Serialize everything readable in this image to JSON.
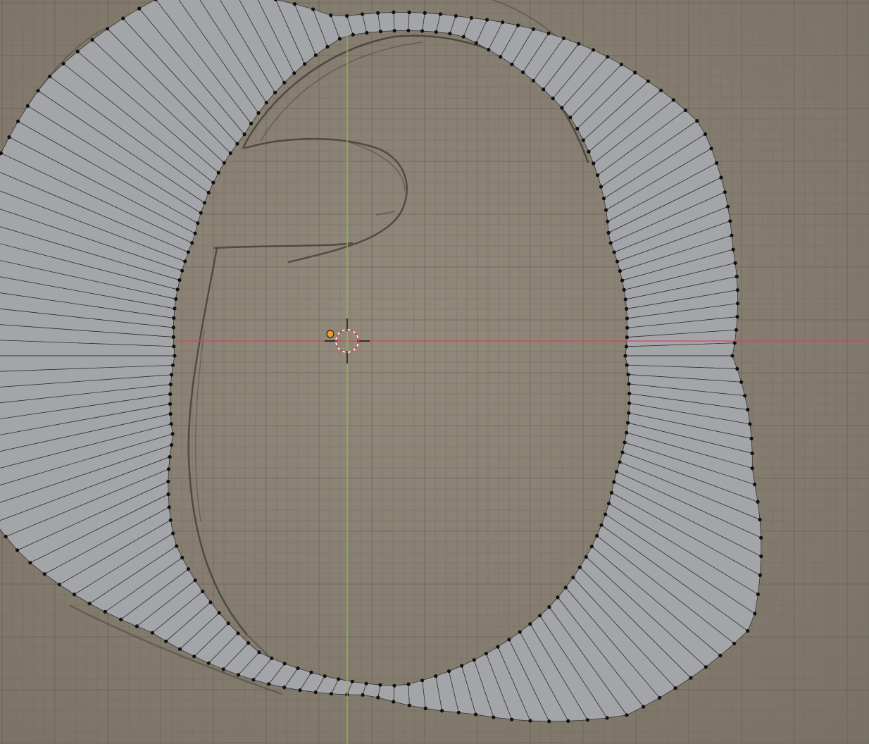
{
  "viewport": {
    "kind": "blender-3d-viewport-top-ortho",
    "colors": {
      "paper_background": "#8a8173",
      "paper_light": "#a39a8a",
      "grid_minor": "#6f6a60",
      "grid_major": "#5f5a51",
      "mesh_face": "#a3a5a8",
      "mesh_edge": "#2a2a2a",
      "vertex": "#111111",
      "x_axis": "#d4485c",
      "y_axis": "#86c24a",
      "origin": "#f0a020",
      "cursor_red": "#cc2b2b",
      "cursor_white": "#ffffff",
      "sketch_pencil": "#3c3935"
    },
    "icons": [
      "3d-cursor-icon",
      "object-origin-icon"
    ]
  }
}
